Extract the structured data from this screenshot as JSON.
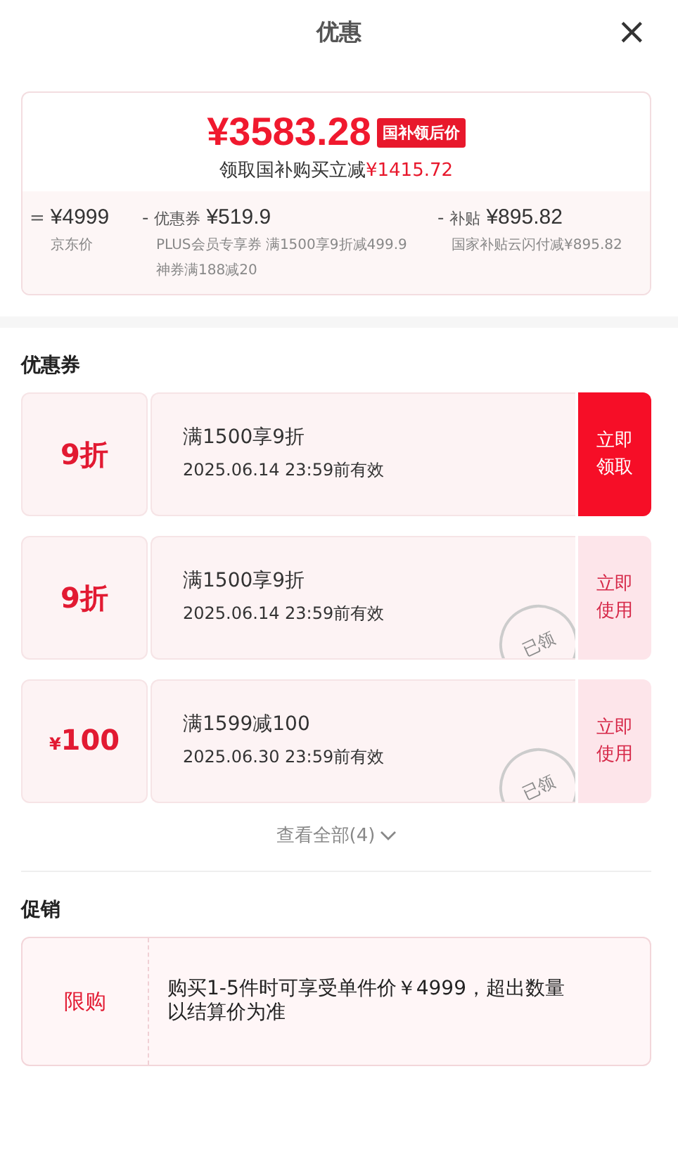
{
  "header": {
    "title": "优惠",
    "close": "×"
  },
  "summary": {
    "price": "¥3583.28",
    "price_tag": "国补领后价",
    "saving_label": "领取国补购买立减",
    "saving_amount": "¥1415.72",
    "breakdown": [
      {
        "op": "=",
        "amount": "¥4999",
        "notes": [
          "京东价"
        ]
      },
      {
        "op": "-",
        "name": "优惠券",
        "amount": "¥519.9",
        "notes": [
          "PLUS会员专享券 满1500享9折减499.9",
          "神券满188减20"
        ]
      },
      {
        "op": "-",
        "name": "补贴",
        "amount": "¥895.82",
        "notes": [
          "国家补贴云闪付减¥895.82"
        ]
      }
    ]
  },
  "coupons": {
    "title": "优惠券",
    "items": [
      {
        "value": "9折",
        "condition": "满1500享9折",
        "validity": "2025.06.14 23:59前有效",
        "action": "立即领取",
        "claimed": false
      },
      {
        "value": "9折",
        "condition": "满1500享9折",
        "validity": "2025.06.14 23:59前有效",
        "action": "立即使用",
        "claimed": true,
        "stamp": "已领"
      },
      {
        "currency": "¥",
        "value": "100",
        "condition": "满1599减100",
        "validity": "2025.06.30 23:59前有效",
        "action": "立即使用",
        "claimed": true,
        "stamp": "已领"
      }
    ],
    "more": "查看全部(4)"
  },
  "promotions": {
    "title": "促销",
    "items": [
      {
        "tag": "限购",
        "text": "购买1-5件时可享受单件价￥4999，超出数量以结算价为准"
      }
    ]
  }
}
